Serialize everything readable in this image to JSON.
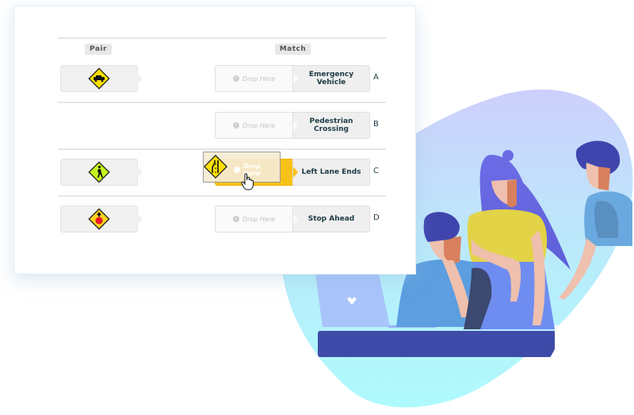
{
  "headers": {
    "pair": "Pair",
    "match": "Match"
  },
  "drop_placeholder": "Drop Here",
  "rows": [
    {
      "letter": "A",
      "answer_line1": "Emergency",
      "answer_line2": "Vehicle",
      "pair_sign": "emergency-vehicle-sign",
      "drop_state": "empty"
    },
    {
      "letter": "B",
      "answer_line1": "Pedestrian",
      "answer_line2": "Crossing",
      "pair_sign": "",
      "drop_state": "empty"
    },
    {
      "letter": "C",
      "answer_line1": "Left Lane Ends",
      "answer_line2": "",
      "pair_sign": "pedestrian-crossing-sign",
      "drop_state": "highlighted"
    },
    {
      "letter": "D",
      "answer_line1": "Stop Ahead",
      "answer_line2": "",
      "pair_sign": "stop-ahead-sign",
      "drop_state": "empty"
    }
  ],
  "dragging": {
    "sign": "left-lane-ends-sign",
    "label": "Drop Here"
  },
  "colors": {
    "highlight": "#f8c118",
    "sign_yellow": "#ffe000",
    "sign_green": "#c6f51b",
    "blob_top": "#c9cdfb",
    "blob_bottom": "#aef8fd",
    "desk": "#3e4ba8"
  }
}
